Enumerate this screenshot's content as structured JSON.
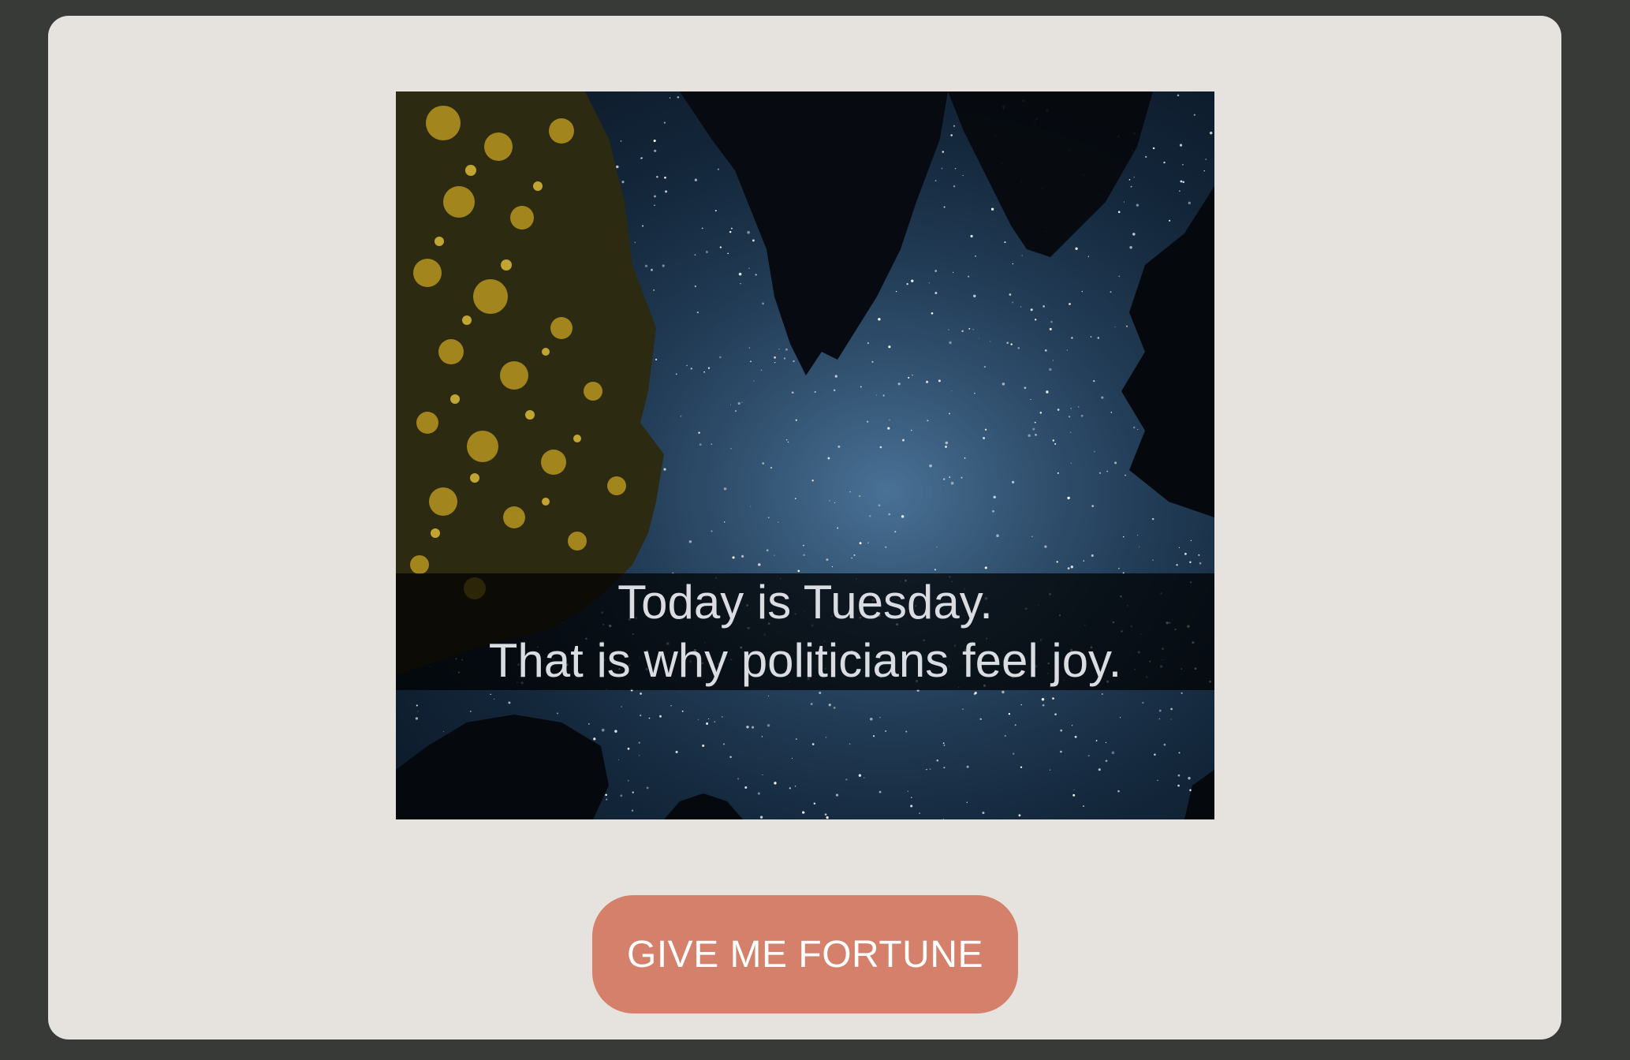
{
  "fortune": {
    "lines": [
      "Today is Tuesday.",
      "That is why politicians feel joy."
    ]
  },
  "button": {
    "label": "GIVE ME FORTUNE"
  },
  "colors": {
    "page_background": "#373a36",
    "card_background": "#e6e3df",
    "button_background": "#d4806a",
    "button_text": "#ffffff",
    "caption_text": "#d9dde2"
  }
}
